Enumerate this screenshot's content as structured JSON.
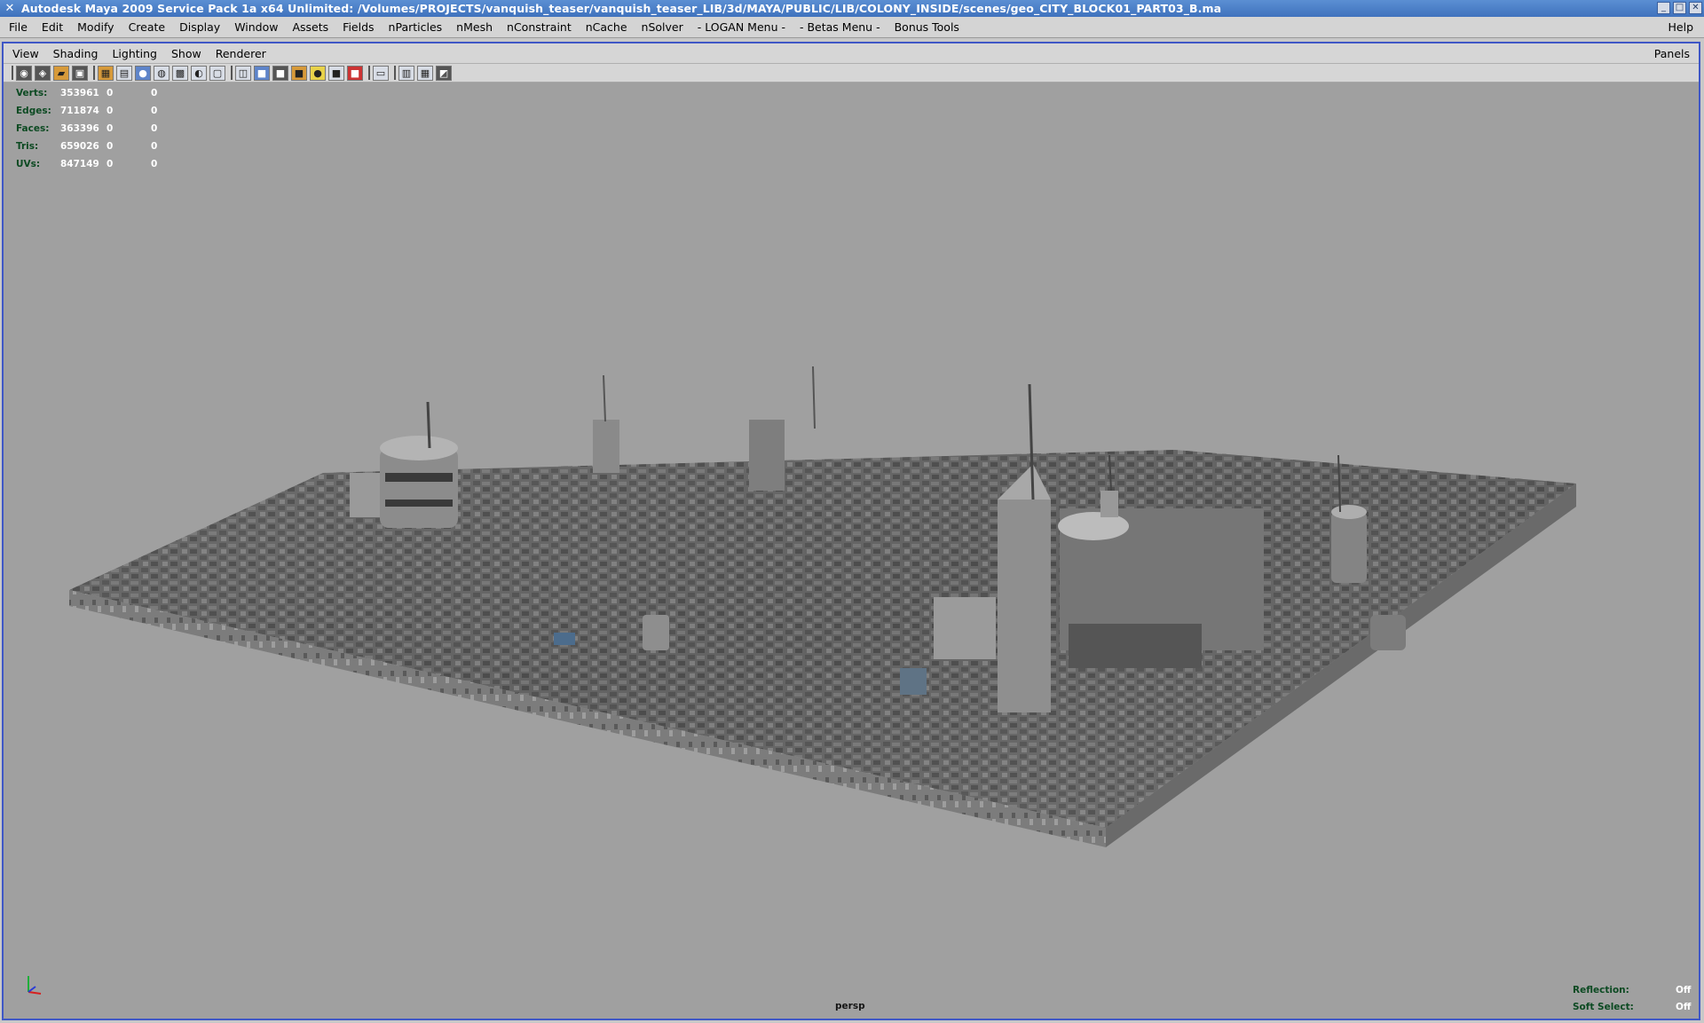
{
  "window": {
    "title": "Autodesk Maya 2009 Service Pack 1a x64 Unlimited: /Volumes/PROJECTS/vanquish_teaser/vanquish_teaser_LIB/3d/MAYA/PUBLIC/LIB/COLONY_INSIDE/scenes/geo_CITY_BLOCK01_PART03_B.ma",
    "app_icon": "maya-x-icon",
    "controls": {
      "minimize": "_",
      "maximize": "□",
      "close": "✕"
    }
  },
  "main_menu": {
    "items": [
      "File",
      "Edit",
      "Modify",
      "Create",
      "Display",
      "Window",
      "Assets",
      "Fields",
      "nParticles",
      "nMesh",
      "nConstraint",
      "nCache",
      "nSolver",
      "- LOGAN Menu -",
      "- Betas Menu -",
      "Bonus Tools"
    ],
    "help": "Help"
  },
  "panel": {
    "menu": [
      "View",
      "Shading",
      "Lighting",
      "Show",
      "Renderer"
    ],
    "panels_label": "Panels",
    "toolbar_icons": [
      "select-camera-icon",
      "lock-camera-icon",
      "bookmark-icon",
      "camera-attributes-icon",
      "grid-icon",
      "wireframe-icon",
      "smooth-shade-icon",
      "textured-icon",
      "lights-icon",
      "shadows-icon",
      "xray-icon",
      "isolate-icon",
      "film-gate-icon",
      "resolution-gate-icon",
      "safe-action-icon",
      "safe-title-icon",
      "field-chart-icon",
      "overscan-icon",
      "image-plane-icon",
      "backface-icon",
      "default-light-icon",
      "ssao-icon",
      "resolution-icon",
      "gate-mask-icon",
      "multisample-icon",
      "motion-blur-icon"
    ]
  },
  "hud": {
    "rows": [
      {
        "label": "Verts:",
        "value": "353961",
        "z1": "0",
        "z2": "0"
      },
      {
        "label": "Edges:",
        "value": "711874",
        "z1": "0",
        "z2": "0"
      },
      {
        "label": "Faces:",
        "value": "363396",
        "z1": "0",
        "z2": "0"
      },
      {
        "label": "Tris:",
        "value": "659026",
        "z1": "0",
        "z2": "0"
      },
      {
        "label": "UVs:",
        "value": "847149",
        "z1": "0",
        "z2": "0"
      }
    ]
  },
  "viewport": {
    "camera": "persp",
    "status": [
      {
        "label": "Reflection:",
        "value": "Off"
      },
      {
        "label": "Soft Select:",
        "value": "Off"
      }
    ]
  },
  "colors": {
    "title_bar": "#4a7fc8",
    "panel_border": "#3f57c6",
    "viewport_bg": "#a0a0a0",
    "hud_label": "#0c4a22"
  }
}
